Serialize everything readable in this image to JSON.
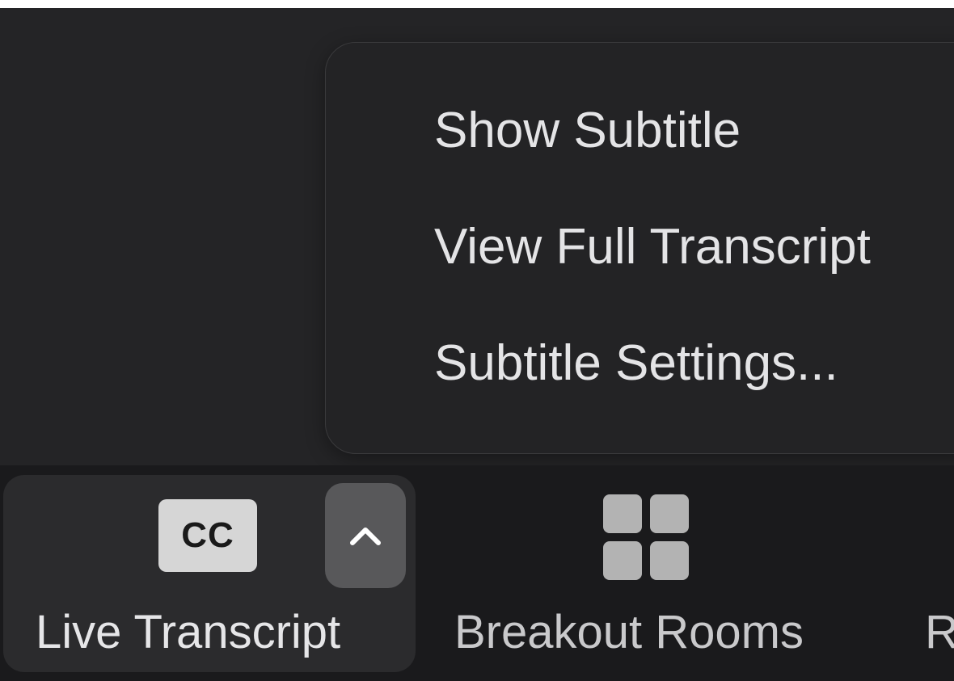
{
  "menu": {
    "items": [
      {
        "label": "Show Subtitle"
      },
      {
        "label": "View Full Transcript"
      },
      {
        "label": "Subtitle Settings..."
      }
    ]
  },
  "toolbar": {
    "live_transcript": {
      "badge": "CC",
      "label": "Live Transcript",
      "caret_icon": "chevron-up-icon"
    },
    "breakout_rooms": {
      "icon": "grid-icon",
      "label": "Breakout Rooms"
    },
    "next_partial": {
      "label": "R"
    }
  },
  "colors": {
    "background": "#242426",
    "menu_text": "#e4e4e6",
    "toolbar_bg": "#1a1a1c",
    "cc_badge": "#d6d6d6",
    "caret_button": "#58585a"
  }
}
